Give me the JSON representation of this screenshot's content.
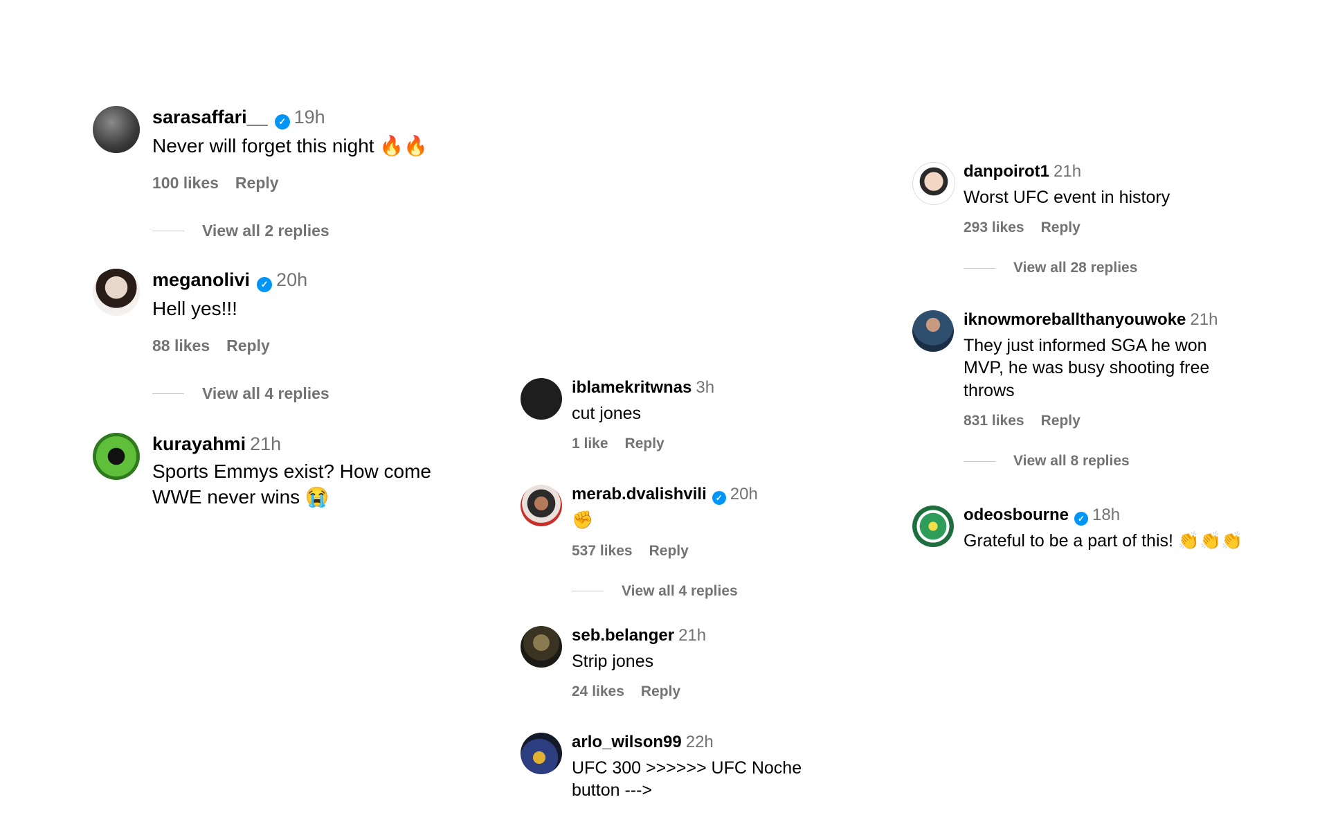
{
  "comments": [
    {
      "username": "sarasaffari__",
      "time": "19h",
      "verified": true,
      "text": "Never will forget this night 🔥🔥",
      "likes": "100 likes",
      "reply": "Reply",
      "view_replies": "View all 2 replies"
    },
    {
      "username": "meganolivi",
      "time": "20h",
      "verified": true,
      "text": "Hell yes!!!",
      "likes": "88 likes",
      "reply": "Reply",
      "view_replies": "View all 4 replies"
    },
    {
      "username": "kurayahmi",
      "time": "21h",
      "verified": false,
      "text": "Sports Emmys exist? How come WWE never wins 😭"
    },
    {
      "username": "iblamekritwnas",
      "time": "3h",
      "verified": false,
      "text": "cut jones",
      "likes": "1 like",
      "reply": "Reply"
    },
    {
      "username": "merab.dvalishvili",
      "time": "20h",
      "verified": true,
      "text": "✊",
      "likes": "537 likes",
      "reply": "Reply",
      "view_replies": "View all 4 replies"
    },
    {
      "username": "seb.belanger",
      "time": "21h",
      "verified": false,
      "text": "Strip jones",
      "likes": "24 likes",
      "reply": "Reply"
    },
    {
      "username": "arlo_wilson99",
      "time": "22h",
      "verified": false,
      "text": "UFC 300 >>>>>> UFC Noche button --->"
    },
    {
      "username": "danpoirot1",
      "time": "21h",
      "verified": false,
      "text": "Worst UFC event in history",
      "likes": "293 likes",
      "reply": "Reply",
      "view_replies": "View all 28 replies"
    },
    {
      "username": "iknowmoreballthanyouwoke",
      "time": "21h",
      "verified": false,
      "text": "They just informed SGA he won MVP, he was busy shooting free throws",
      "likes": "831 likes",
      "reply": "Reply",
      "view_replies": "View all 8 replies"
    },
    {
      "username": "odeosbourne",
      "time": "18h",
      "verified": true,
      "text": "Grateful to be a part of this! 👏👏👏"
    }
  ],
  "icons": {
    "verified": "verified-badge-icon"
  },
  "colors": {
    "muted": "#737373",
    "verified": "#0095f6"
  }
}
